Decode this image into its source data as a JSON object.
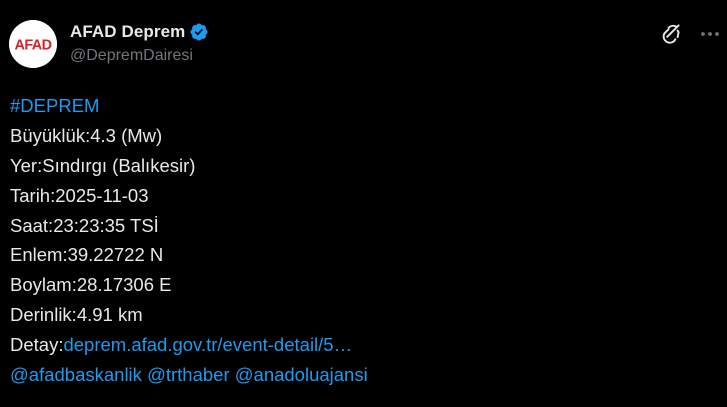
{
  "author": {
    "display_name": "AFAD Deprem",
    "handle": "@DepremDairesi",
    "avatar_text": "AFAD",
    "verified": true
  },
  "icons": {
    "verified": "verified-badge-icon",
    "grok": "grok-icon",
    "more": "more-options-icon"
  },
  "colors": {
    "background": "#000000",
    "text": "#e7e9ea",
    "muted": "#71767b",
    "link": "#1d9bf0",
    "afad_red": "#d8232a"
  },
  "tweet": {
    "hashtag": "#DEPREM",
    "magnitude": "Büyüklük:4.3 (Mw)",
    "location": "Yer:Sındırgı (Balıkesir)",
    "date": "Tarih:2025-11-03",
    "time": "Saat:23:23:35 TSİ",
    "latitude": "Enlem:39.22722 N",
    "longitude": "Boylam:28.17306 E",
    "depth": "Derinlik:4.91 km",
    "detail_label": "Detay:",
    "detail_link": "deprem.afad.gov.tr/event-detail/5…",
    "mentions": [
      "@afadbaskanlik",
      "@trthaber",
      "@anadoluajansi"
    ]
  }
}
